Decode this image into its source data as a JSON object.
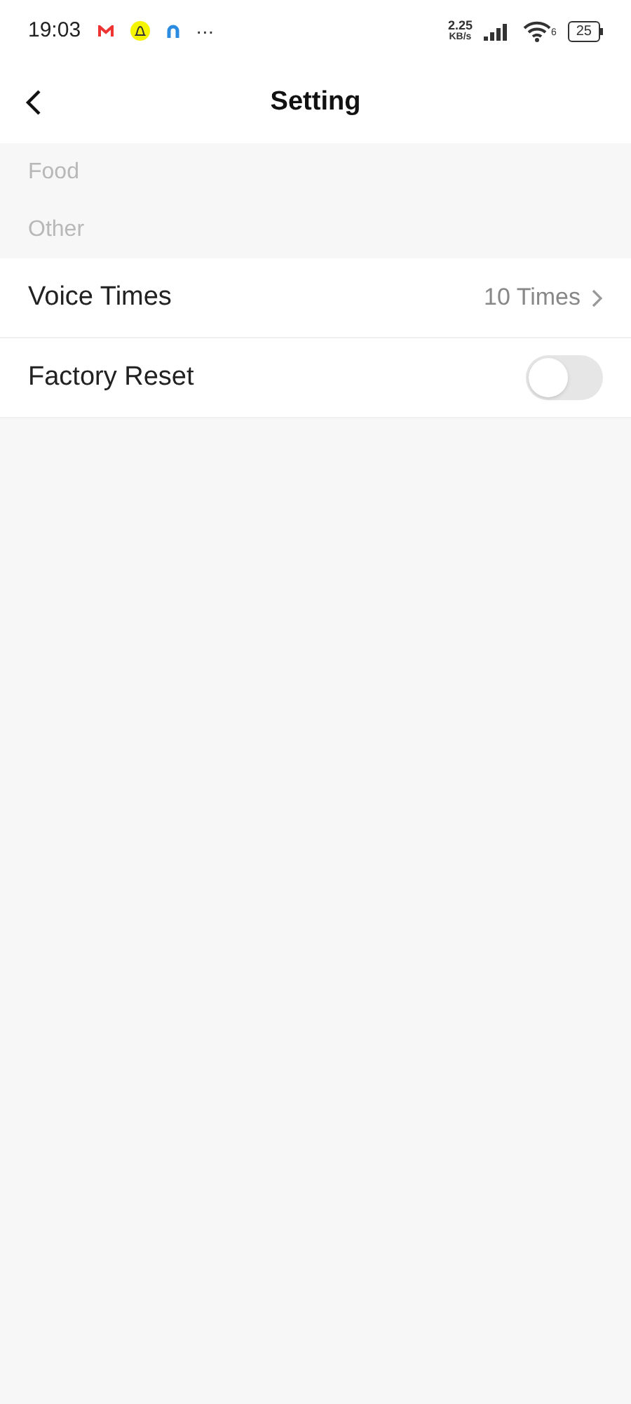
{
  "status_bar": {
    "time": "19:03",
    "more": "···",
    "speed_value": "2.25",
    "speed_unit": "KB/s",
    "wifi_badge": "6",
    "battery": "25"
  },
  "header": {
    "title": "Setting"
  },
  "sections": [
    {
      "label": "Food"
    },
    {
      "label": "Other"
    }
  ],
  "rows": [
    {
      "kind": "value",
      "label": "Voice Times",
      "value": "10 Times"
    },
    {
      "kind": "toggle",
      "label": "Factory Reset",
      "on": false
    }
  ]
}
